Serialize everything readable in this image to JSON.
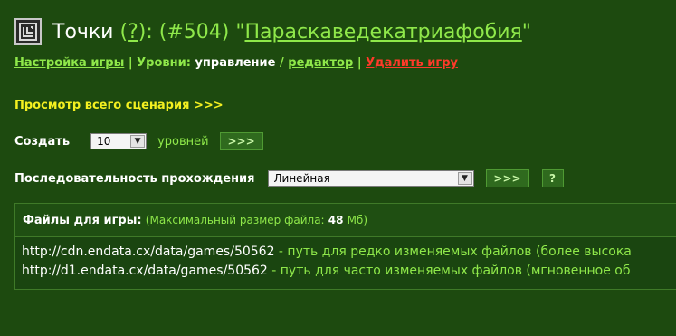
{
  "header": {
    "prefix": "Точки",
    "open_paren": "(",
    "help_link": "?",
    "close_paren_colon": "):",
    "game_number": "(#504)",
    "quote_open": "\"",
    "game_name": "Параскаведекатриафобия",
    "quote_close": "\""
  },
  "menu": {
    "settings": "Настройка игры",
    "sep1": "|",
    "levels_label": "Уровни:",
    "levels_manage": "управление",
    "slash": "/",
    "levels_editor": "редактор",
    "sep2": "|",
    "delete": "Удалить игру"
  },
  "scenario_link": "Просмотр всего сценария >>>",
  "create": {
    "label": "Создать",
    "count": "10",
    "suffix": "уровней",
    "button": ">>>"
  },
  "sequence": {
    "label": "Последовательность прохождения",
    "value": "Линейная",
    "button": ">>>",
    "help": "?"
  },
  "files": {
    "title": "Файлы для игры:",
    "max_label": "(Максимальный размер файла:",
    "max_value": "48",
    "max_unit": "Мб)",
    "lines": [
      {
        "url": "http://cdn.endata.cx/data/games/50562",
        "desc": " - путь для редко изменяемых файлов (более высока"
      },
      {
        "url": "http://d1.endata.cx/data/games/50562",
        "desc": " - путь для часто изменяемых файлов (мгновенное об"
      }
    ]
  },
  "colors": {
    "background": "#1d4a0f",
    "link_green": "#8fe84a",
    "warning_red": "#ff3a2a",
    "scenario_yellow": "#f4f020"
  }
}
